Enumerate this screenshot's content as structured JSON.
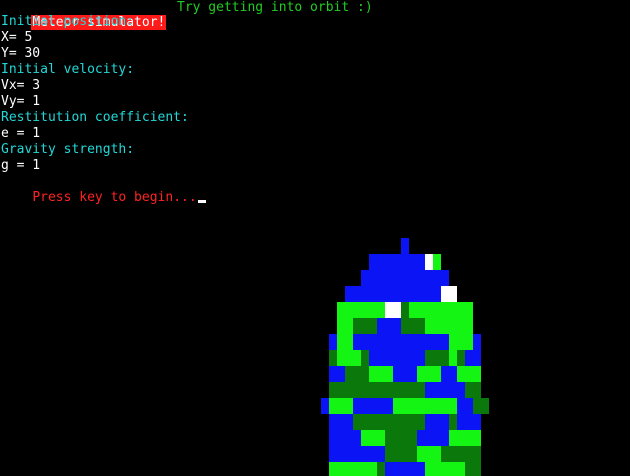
{
  "window": {
    "title": "Meteor simulator!",
    "tip": "Try getting into orbit :)"
  },
  "colors": {
    "background": "#000000",
    "title_bg": "#ff1a1a",
    "tip": "#22cc22",
    "heading": "#22d8d8",
    "value": "#ffffff",
    "prompt": "#ff2222",
    "planet_blue": "#0a14f5",
    "planet_lime": "#14f514",
    "planet_green": "#0a780a",
    "planet_white": "#ffffff"
  },
  "fields": {
    "position_heading": "Initial position:",
    "x": "X= 5",
    "y": "Y= 30",
    "velocity_heading": "Initial velocity:",
    "vx": "Vx= 3",
    "vy": "Vy= 1",
    "restitution_heading": "Restitution coefficient:",
    "e": "e = 1",
    "gravity_heading": "Gravity strength:",
    "g": "g = 1"
  },
  "prompt": "Press key to begin..."
}
